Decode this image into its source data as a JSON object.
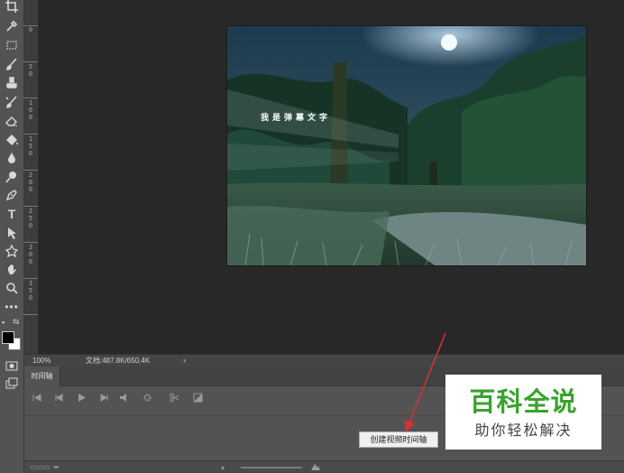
{
  "canvas": {
    "overlay_text": "我是弹幕文字"
  },
  "ruler": {
    "labels": [
      "0",
      "5 0",
      "1 0 0",
      "1 5 0",
      "2 0 0",
      "2 5 0",
      "3 0 0",
      "3 5 0"
    ]
  },
  "status": {
    "zoom": "100%",
    "doc_info": "文档:487.8K/650.4K",
    "arrow": "›"
  },
  "timeline": {
    "tab_label": "时间轴",
    "create_button_label": "创建视频时间轴"
  },
  "watermark": {
    "title": "百科全说",
    "subtitle": "助你轻松解决",
    "accent_color": "#3aa22e"
  },
  "colors": {
    "workspace": "#282828",
    "panel": "#535353",
    "annotation_arrow": "#d23232"
  },
  "icons": [
    "crop-icon",
    "eyedropper-icon",
    "marquee-icon",
    "brush-icon",
    "stamp-icon",
    "history-brush-icon",
    "eraser-icon",
    "paint-bucket-icon",
    "blur-icon",
    "dodge-icon",
    "pen-icon",
    "type-icon",
    "path-select-icon",
    "shape-icon",
    "hand-icon",
    "zoom-icon",
    "more-icon",
    "swap-colors-icon",
    "quick-mask-icon",
    "screen-mode-icon"
  ]
}
